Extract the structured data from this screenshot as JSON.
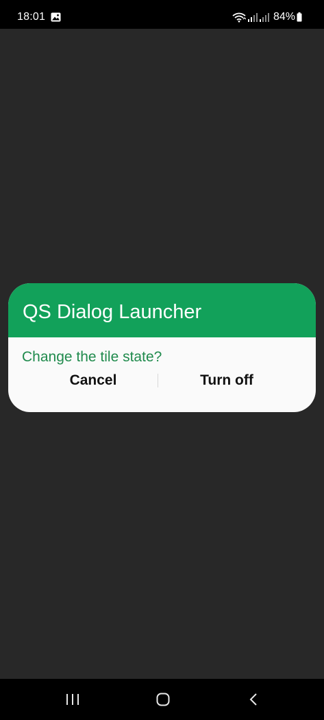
{
  "status_bar": {
    "time": "18:01",
    "battery": "84%",
    "icons": [
      "image-notification-icon",
      "wifi-icon",
      "signal-icon",
      "signal-icon",
      "battery-icon"
    ]
  },
  "dialog": {
    "title": "QS Dialog Launcher",
    "message": "Change the tile state?",
    "cancel_label": "Cancel",
    "confirm_label": "Turn off"
  },
  "nav_bar": {
    "icons": [
      "recents-icon",
      "home-icon",
      "back-icon"
    ]
  },
  "colors": {
    "header": "#12a15a",
    "message_text": "#1f8a4c",
    "background_scrim": "#282828",
    "dialog_body": "#fafafa"
  }
}
